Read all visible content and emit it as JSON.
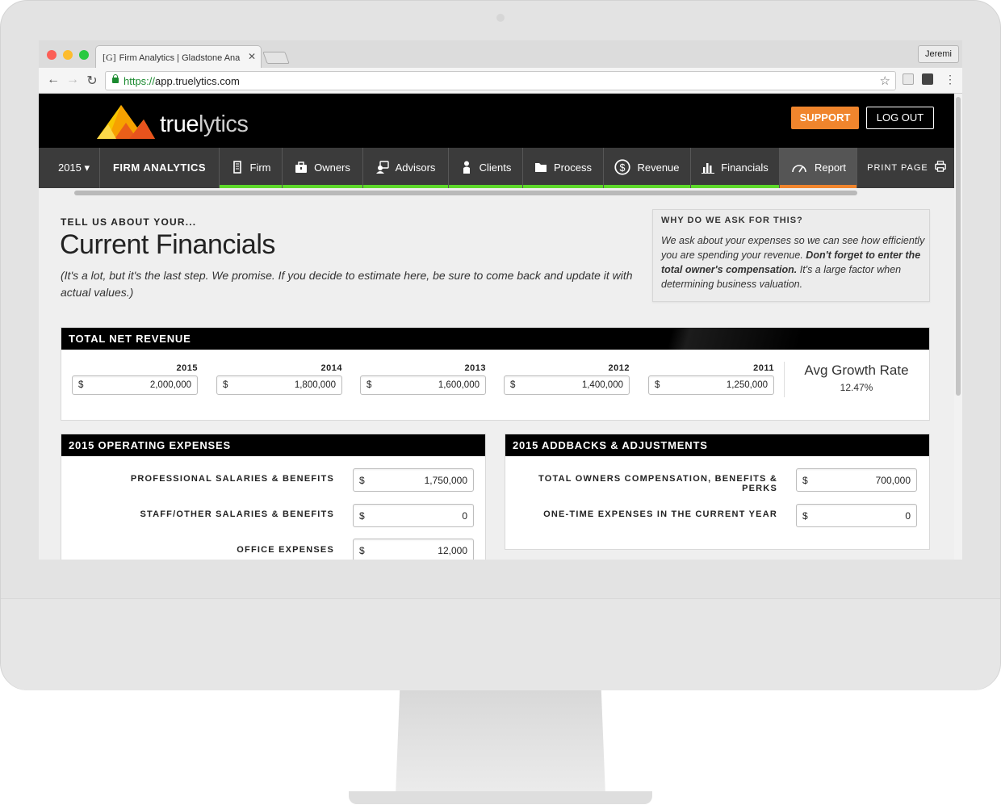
{
  "browser": {
    "tab_favicon": "[G]",
    "tab_title": "Firm Analytics | Gladstone Ana",
    "tab_close": "✕",
    "profile_name": "Jeremi",
    "url_scheme": "https://",
    "url_host": "app.truelytics.com",
    "icons": [
      "back-arrow-icon",
      "forward-arrow-icon",
      "reload-icon",
      "lock-icon",
      "star-icon",
      "extension-icon",
      "menu-dots-icon"
    ]
  },
  "header": {
    "logo_text_bold": "true",
    "logo_text_light": "lytics",
    "support_label": "SUPPORT",
    "logout_label": "LOG OUT",
    "accent": "#f0852d"
  },
  "nav": {
    "year": "2015 ▾",
    "section": "FIRM ANALYTICS",
    "items": [
      {
        "label": "Firm",
        "icon": "building-icon",
        "state": "done"
      },
      {
        "label": "Owners",
        "icon": "briefcase-icon",
        "state": "done"
      },
      {
        "label": "Advisors",
        "icon": "advisor-icon",
        "state": "done"
      },
      {
        "label": "Clients",
        "icon": "person-icon",
        "state": "done"
      },
      {
        "label": "Process",
        "icon": "folder-icon",
        "state": "done"
      },
      {
        "label": "Revenue",
        "icon": "dollar-circle-icon",
        "state": "done"
      },
      {
        "label": "Financials",
        "icon": "bar-chart-icon",
        "state": "current"
      },
      {
        "label": "Report",
        "icon": "gauge-icon",
        "state": "active"
      }
    ],
    "print_label": "PRINT PAGE",
    "done_color": "#5ed92b"
  },
  "intro": {
    "kicker": "TELL US ABOUT YOUR...",
    "title": "Current Financials",
    "note": "(It's a lot, but it's the last step. We promise. If you decide to estimate here, be sure to come back and update it with actual values.)"
  },
  "why": {
    "title": "WHY DO WE ASK FOR THIS?",
    "text_1": "We ask about your expenses so we can see how efficiently you are spending your revenue. ",
    "text_bold": "Don't forget to enter the total owner's compensation.",
    "text_2": " It's a large factor when determining business valuation."
  },
  "revenue": {
    "title": "TOTAL NET REVENUE",
    "currency": "$",
    "years": [
      {
        "year": "2015",
        "value": "2,000,000"
      },
      {
        "year": "2014",
        "value": "1,800,000"
      },
      {
        "year": "2013",
        "value": "1,600,000"
      },
      {
        "year": "2012",
        "value": "1,400,000"
      },
      {
        "year": "2011",
        "value": "1,250,000"
      }
    ],
    "growth_label": "Avg Growth Rate",
    "growth_value": "12.47%"
  },
  "opex": {
    "title": "2015 OPERATING EXPENSES",
    "currency": "$",
    "rows": [
      {
        "label": "PROFESSIONAL SALARIES & BENEFITS",
        "value": "1,750,000"
      },
      {
        "label": "STAFF/OTHER SALARIES & BENEFITS",
        "value": "0"
      },
      {
        "label": "OFFICE EXPENSES",
        "value": "12,000"
      }
    ]
  },
  "addbacks": {
    "title": "2015 ADDBACKS & ADJUSTMENTS",
    "currency": "$",
    "rows": [
      {
        "label": "TOTAL OWNERS COMPENSATION, BENEFITS & PERKS",
        "value": "700,000"
      },
      {
        "label": "ONE-TIME EXPENSES IN THE CURRENT YEAR",
        "value": "0"
      }
    ]
  }
}
